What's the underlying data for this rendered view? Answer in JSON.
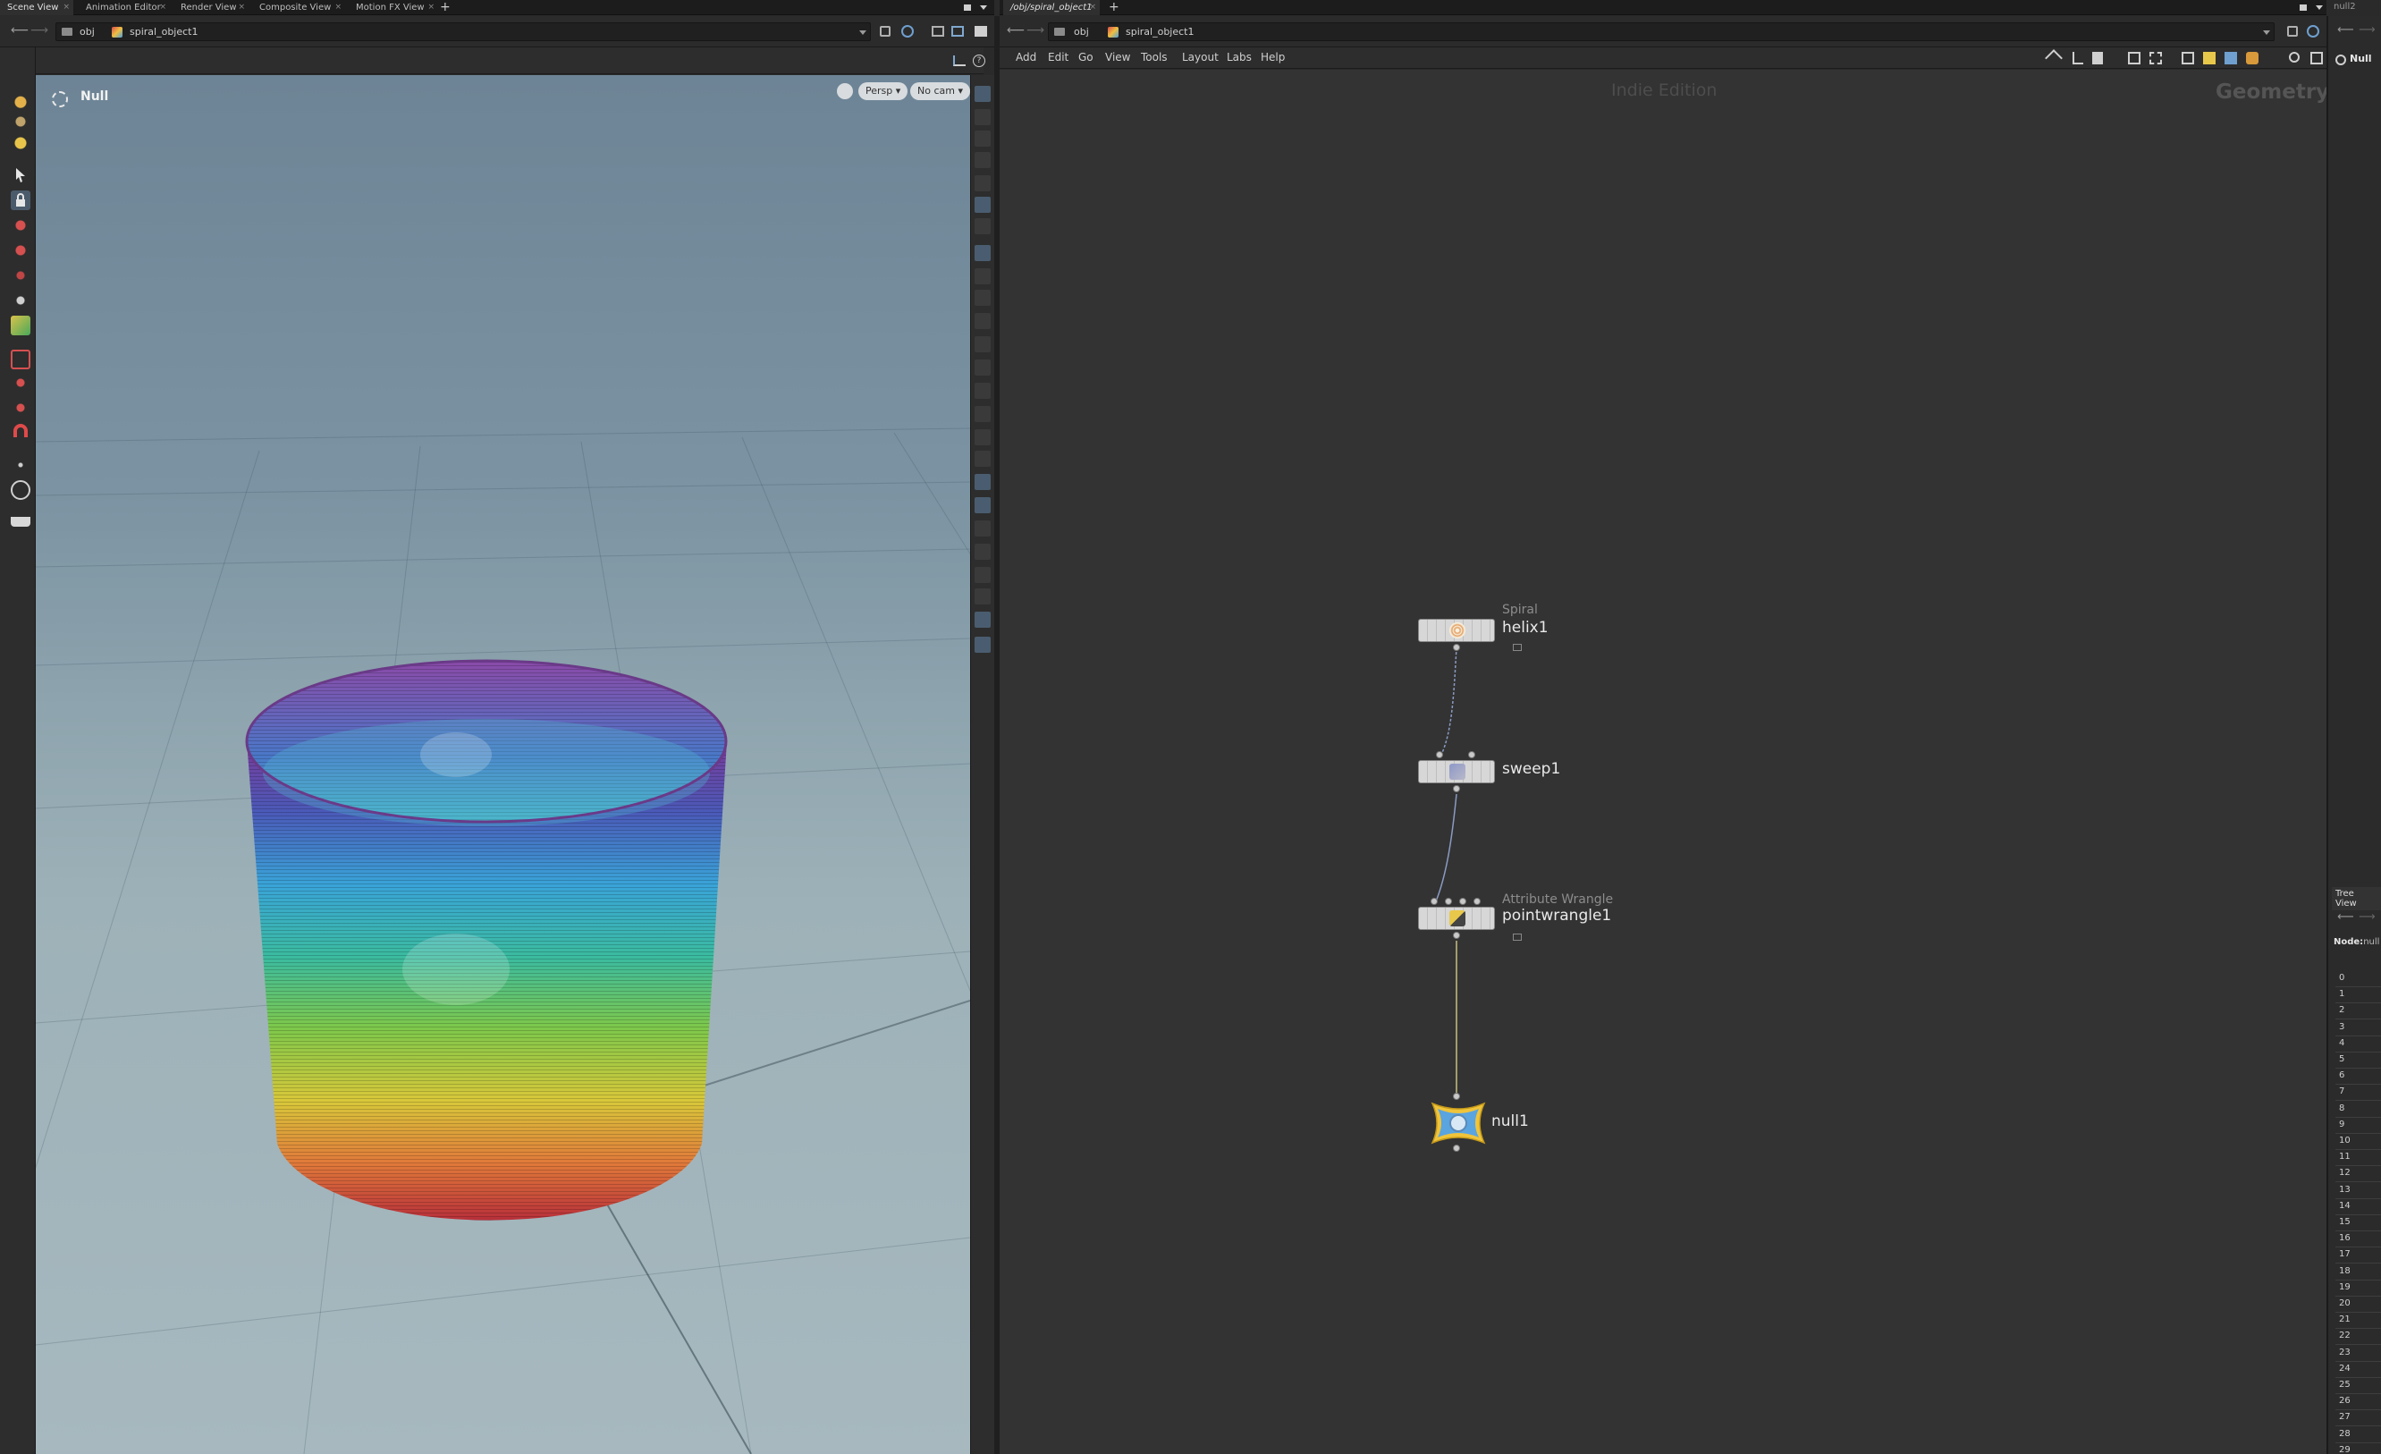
{
  "left_tabs": [
    {
      "label": "Scene View",
      "active": true
    },
    {
      "label": "Animation Editor",
      "active": false
    },
    {
      "label": "Render View",
      "active": false
    },
    {
      "label": "Composite View",
      "active": false
    },
    {
      "label": "Motion FX View",
      "active": false
    }
  ],
  "right_tab": {
    "label": "/obj/spiral_object1"
  },
  "far_right_tab": {
    "label": "null2"
  },
  "plus_glyph": "+",
  "close_glyph": "×",
  "left_path": {
    "root": "obj",
    "object": "spiral_object1"
  },
  "net_path": {
    "root": "obj",
    "object": "spiral_object1"
  },
  "viewport": {
    "title": "Null",
    "persp": "Persp ▾",
    "camera": "No cam ▾"
  },
  "net_menu": [
    "Add",
    "Edit",
    "Go",
    "View",
    "Tools",
    "Layout",
    "Labs",
    "Help"
  ],
  "network": {
    "watermark": "Indie Edition",
    "context": "Geometry",
    "nodes": [
      {
        "type": "Spiral",
        "name": "helix1"
      },
      {
        "type": "",
        "name": "sweep1"
      },
      {
        "type": "Attribute Wrangle",
        "name": "pointwrangle1"
      },
      {
        "type": "",
        "name": "null1"
      }
    ]
  },
  "right_panel": {
    "title": "Null",
    "tree_view": "Tree View",
    "node_label": "Node:",
    "node_value": "null",
    "rows": [
      "0",
      "1",
      "2",
      "3",
      "4",
      "5",
      "6",
      "7",
      "8",
      "9",
      "10",
      "11",
      "12",
      "13",
      "14",
      "15",
      "16",
      "17",
      "18",
      "19",
      "20",
      "21",
      "22",
      "23",
      "24",
      "25",
      "26",
      "27",
      "28",
      "29"
    ]
  },
  "icons": {
    "back": "back-arrow-icon",
    "forward": "forward-arrow-icon",
    "grid": "grid-icon",
    "lock": "lock-icon"
  },
  "colors": {
    "bg_dark": "#2a2a2a",
    "network_bg": "#333333",
    "active_tool": "#4b5b6b",
    "wire": "#8a9bc4",
    "wire_yellow": "#c8c080"
  }
}
